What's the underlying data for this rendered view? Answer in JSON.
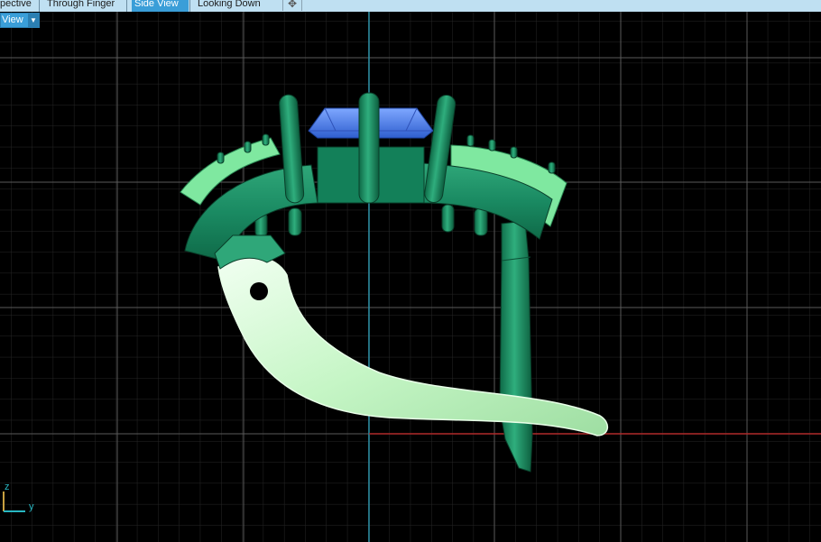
{
  "tabs": [
    {
      "label": "pective",
      "active": false
    },
    {
      "label": "Through Finger",
      "active": false
    },
    {
      "label": "Side View",
      "active": true
    },
    {
      "label": "Looking Down",
      "active": false
    }
  ],
  "add_tab_icon": "plus-icon",
  "view_label": {
    "text": "View",
    "dropdown_icon": "triangle-down-icon"
  },
  "axis_gizmo": {
    "vertical": "z",
    "horizontal": "y"
  },
  "colors": {
    "background": "#000000",
    "grid_major": "#606060",
    "grid_minor": "#2a2a2a",
    "vertical_axis": "#2a8fa6",
    "horizontal_axis": "#b02a2a",
    "tab_active": "#3a9ed8",
    "tab_strip": "#bfe0f2",
    "model_dark_green": "#137a55",
    "model_light_green": "#7fe8a0",
    "model_pale_green": "#ccf7cc",
    "gem_blue": "#4a7fe0"
  }
}
